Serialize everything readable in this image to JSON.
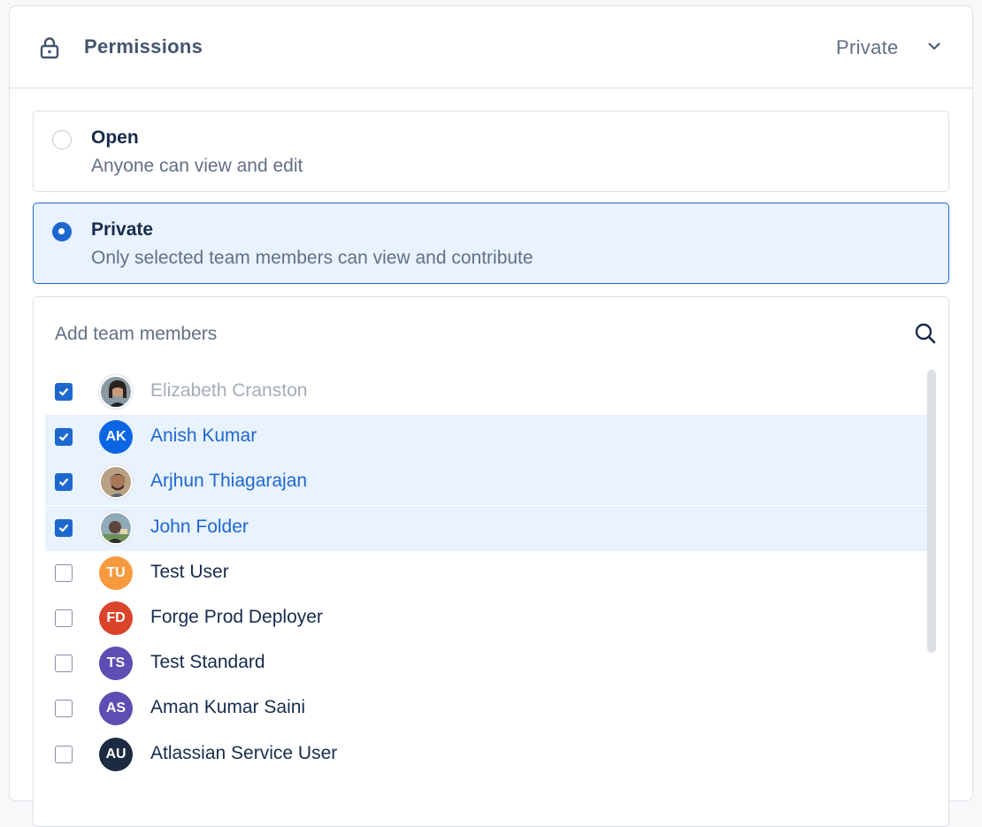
{
  "header": {
    "title": "Permissions",
    "value": "Private"
  },
  "options": [
    {
      "title": "Open",
      "description": "Anyone can view and edit",
      "selected": false
    },
    {
      "title": "Private",
      "description": "Only selected team members can view and contribute",
      "selected": true
    }
  ],
  "members_panel": {
    "label": "Add team members",
    "members": [
      {
        "name": "Elizabeth Cranston",
        "checked": true,
        "avatar": "photo",
        "initials": ""
      },
      {
        "name": "Anish Kumar",
        "checked": true,
        "avatar": "initials",
        "initials": "AK",
        "color": "#0c66e4"
      },
      {
        "name": "Arjhun Thiagarajan",
        "checked": true,
        "avatar": "photo",
        "initials": ""
      },
      {
        "name": "John Folder",
        "checked": true,
        "avatar": "photo",
        "initials": ""
      },
      {
        "name": "Test User",
        "checked": false,
        "avatar": "initials",
        "initials": "TU",
        "color": "#f79a3e"
      },
      {
        "name": "Forge Prod Deployer",
        "checked": false,
        "avatar": "initials",
        "initials": "FD",
        "color": "#d9442a"
      },
      {
        "name": "Test Standard",
        "checked": false,
        "avatar": "initials",
        "initials": "TS",
        "color": "#5e4db2"
      },
      {
        "name": "Aman Kumar Saini",
        "checked": false,
        "avatar": "initials",
        "initials": "AS",
        "color": "#5e4db2"
      },
      {
        "name": "Atlassian Service User",
        "checked": false,
        "avatar": "initials",
        "initials": "AU",
        "color": "#1c2b41"
      }
    ]
  },
  "colors": {
    "accent": "#1d68cf",
    "selected_bg": "#e9f2ff",
    "border": "#dcdfe4"
  },
  "icons": {
    "lock": "lock-icon",
    "chevron": "chevron-down-icon",
    "search": "search-icon"
  }
}
